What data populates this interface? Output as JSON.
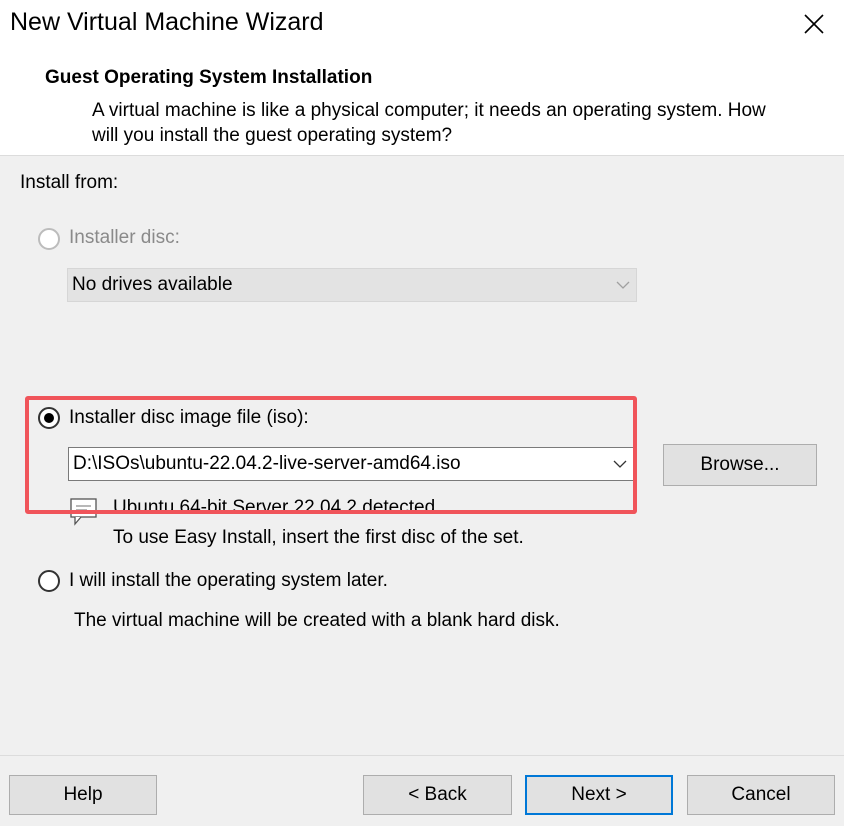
{
  "window": {
    "title": "New Virtual Machine Wizard",
    "close_icon": "close-icon"
  },
  "header": {
    "title": "Guest Operating System Installation",
    "description": "A virtual machine is like a physical computer; it needs an operating system. How will you install the guest operating system?"
  },
  "install_from": {
    "label": "Install from:",
    "installer_disc": {
      "label": "Installer disc:",
      "selected": false,
      "enabled": false,
      "dropdown_value": "No drives available"
    },
    "iso_file": {
      "label": "Installer disc image file (iso):",
      "selected": true,
      "path_value": "D:\\ISOs\\ubuntu-22.04.2-live-server-amd64.iso",
      "browse_label": "Browse...",
      "info_icon": "message-icon",
      "detected_line1": "Ubuntu 64-bit Server 22.04.2 detected.",
      "detected_line2": "To use Easy Install, insert the first disc of the set."
    },
    "later": {
      "label": "I will install the operating system later.",
      "selected": false,
      "description": "The virtual machine will be created with a blank hard disk."
    }
  },
  "footer": {
    "help_label": "Help",
    "back_label": "< Back",
    "next_label": "Next >",
    "cancel_label": "Cancel"
  },
  "colors": {
    "highlight": "#f0545a",
    "default_button_border": "#0078d7",
    "dialog_background": "#f0f0f0"
  }
}
